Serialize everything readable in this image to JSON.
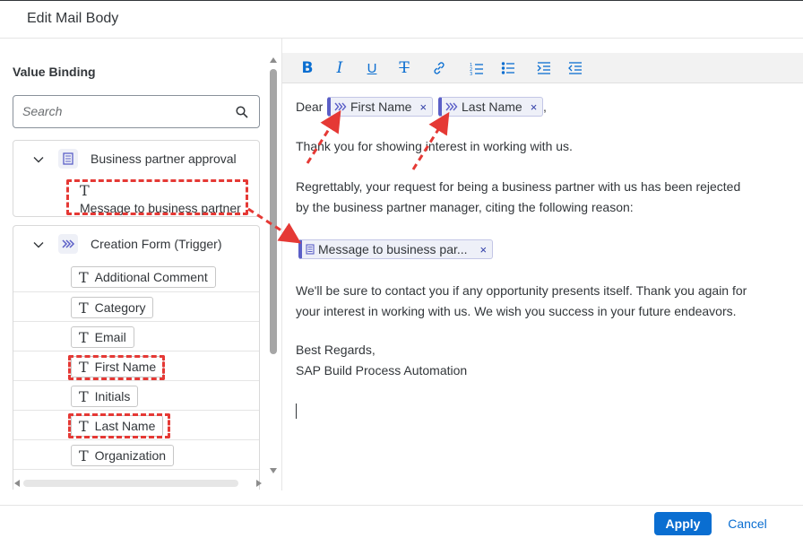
{
  "dialog": {
    "title": "Edit Mail Body"
  },
  "left_panel": {
    "heading": "Value Binding",
    "search_placeholder": "Search",
    "groups": [
      {
        "label": "Business partner approval",
        "icon": "form-document-icon",
        "expanded": true,
        "items": [
          {
            "glyph": "T",
            "label": "Message to business partner"
          }
        ]
      },
      {
        "label": "Creation Form (Trigger)",
        "icon": "trigger-chevrons-icon",
        "expanded": true,
        "items": [
          {
            "glyph": "T",
            "label": "Additional Comment"
          },
          {
            "glyph": "T",
            "label": "Category"
          },
          {
            "glyph": "T",
            "label": "Email"
          },
          {
            "glyph": "T",
            "label": "First Name"
          },
          {
            "glyph": "T",
            "label": "Initials"
          },
          {
            "glyph": "T",
            "label": "Last Name"
          },
          {
            "glyph": "T",
            "label": "Organization"
          }
        ]
      }
    ]
  },
  "toolbar": {
    "buttons": [
      "bold-icon",
      "italic-icon",
      "underline-icon",
      "strikethrough-icon",
      "link-icon",
      "numbered-list-icon",
      "bullet-list-icon",
      "indent-icon",
      "outdent-icon"
    ],
    "bold": "B",
    "italic": "I",
    "underline": "U",
    "strike": "T"
  },
  "editor": {
    "greeting": "Dear",
    "token_first_name": "First Name",
    "token_last_name": "Last Name",
    "comma": ",",
    "token_message": "Message to business par...",
    "token_close": "×",
    "para1": "Thank you for showing interest in working with us.",
    "para2": "Regrettably, your request for being a business partner with us has been rejected by the business partner manager, citing the following reason:",
    "para3": "We'll be sure to contact you if any opportunity presents itself. Thank you again for your interest in working with us. We wish you success in your future endeavors.",
    "sign1": "Best Regards,",
    "sign2": "SAP Build Process Automation"
  },
  "footer": {
    "apply": "Apply",
    "cancel": "Cancel"
  },
  "colors": {
    "accent": "#0a6ed1",
    "token_border": "#5b5fc7",
    "annotation_red": "#e53935"
  }
}
